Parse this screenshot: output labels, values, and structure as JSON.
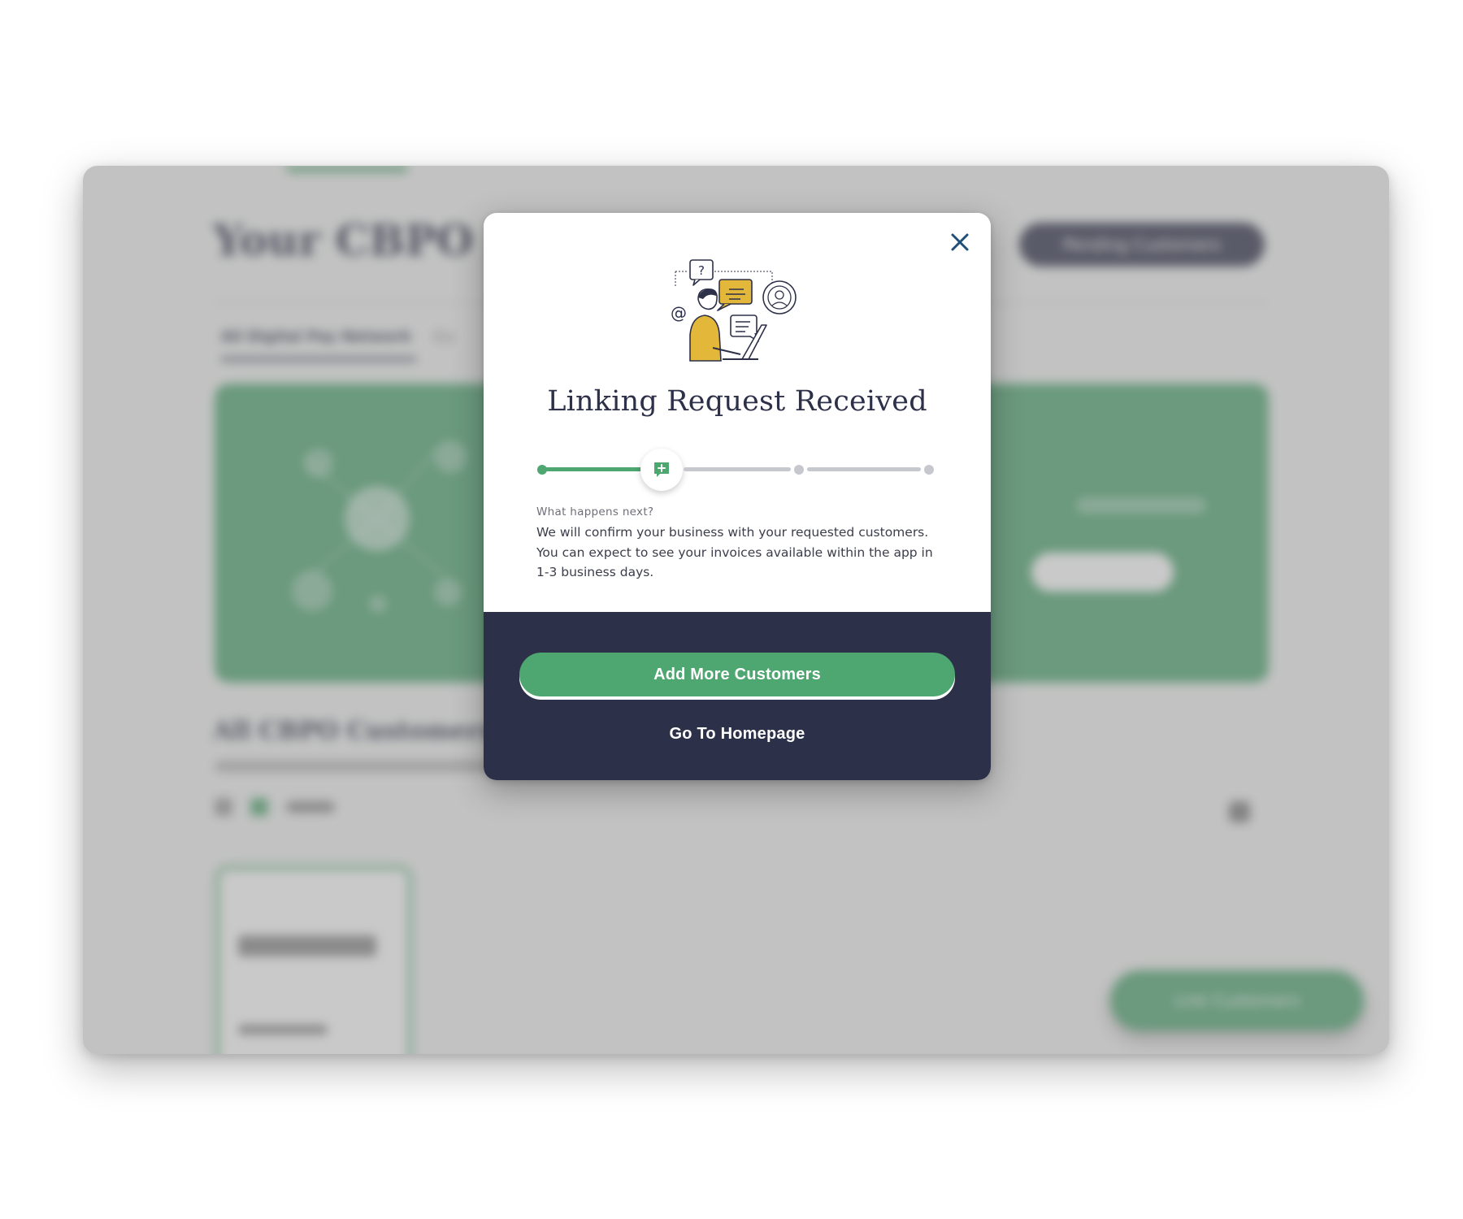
{
  "background_app": {
    "title": "Your CBPO",
    "header_button": "Pending Customers",
    "tabs": [
      "All Digital Pay Network",
      "Cu"
    ],
    "section_title": "All CBPO Customers",
    "fab_label": "Link Customers"
  },
  "modal": {
    "close_icon": "close-icon",
    "illustration_icon": "customer-support-illustration",
    "title": "Linking Request Received",
    "progress": {
      "total_steps": 4,
      "current_step": 2,
      "current_step_icon": "chat-plus-icon"
    },
    "next_heading": "What happens next?",
    "next_body": "We will confirm your business with your requested customers. You can expect to see your invoices available within the app in 1-3 business days.",
    "primary_button": "Add More Customers",
    "secondary_button": "Go To Homepage"
  },
  "colors": {
    "accent_green": "#4ea671",
    "navy": "#2d3049",
    "inactive_gray": "#c6c8ce",
    "close_icon_blue": "#1f4e79"
  }
}
